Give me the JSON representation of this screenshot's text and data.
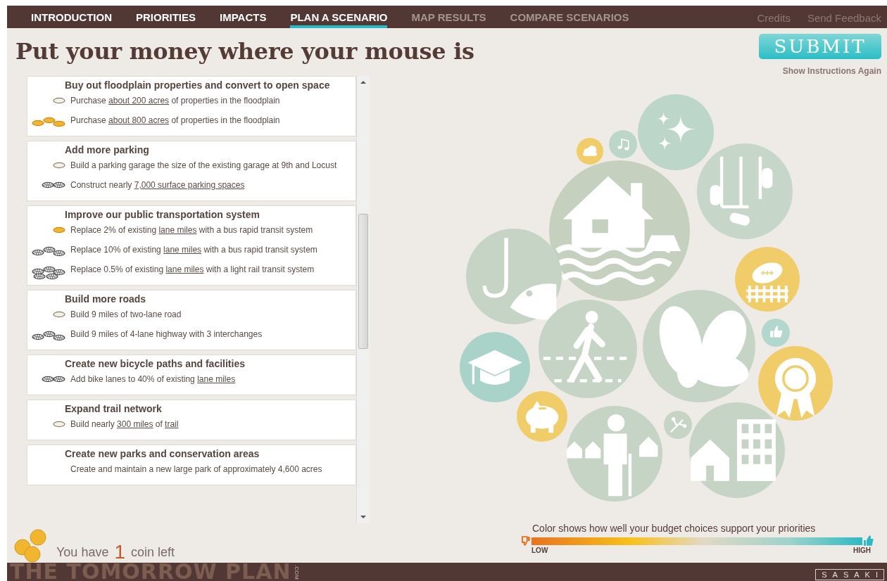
{
  "nav": {
    "tabs": [
      {
        "label": "INTRODUCTION",
        "selected": false,
        "disabled": false
      },
      {
        "label": "PRIORITIES",
        "selected": false,
        "disabled": false
      },
      {
        "label": "IMPACTS",
        "selected": false,
        "disabled": false
      },
      {
        "label": "PLAN A SCENARIO",
        "selected": true,
        "disabled": false
      },
      {
        "label": "MAP RESULTS",
        "selected": false,
        "disabled": true
      },
      {
        "label": "COMPARE SCENARIOS",
        "selected": false,
        "disabled": true
      }
    ],
    "links": [
      "Credits",
      "Send Feedback"
    ]
  },
  "title": "Put your money where your mouse is",
  "submit": "SUBMIT",
  "instructions_link": "Show Instructions Again",
  "projects": [
    {
      "heading": "Buy out floodplain properties and convert to open space",
      "options": [
        {
          "kind": "outline_single",
          "parts": [
            {
              "text": "Purchase "
            },
            {
              "text": "about 200 acres",
              "link": true
            },
            {
              "text": " of properties in the floodplain"
            }
          ]
        },
        {
          "kind": "gold_triple",
          "parts": [
            {
              "text": "Purchase "
            },
            {
              "text": "about 800 acres",
              "link": true
            },
            {
              "text": " of properties in the floodplain"
            }
          ]
        }
      ]
    },
    {
      "heading": "Add more parking",
      "options": [
        {
          "kind": "outline_single",
          "parts": [
            {
              "text": "Build a parking garage the size of the existing garage at 9th and Locust"
            }
          ]
        },
        {
          "kind": "striped_double",
          "parts": [
            {
              "text": "Construct nearly "
            },
            {
              "text": "7,000 surface parking spaces",
              "link": true
            }
          ]
        }
      ]
    },
    {
      "heading": "Improve our public transportation system",
      "options": [
        {
          "kind": "gold_single",
          "parts": [
            {
              "text": "Replace 2% of existing "
            },
            {
              "text": "lane miles",
              "link": true
            },
            {
              "text": " with a bus rapid transit system"
            }
          ]
        },
        {
          "kind": "striped_triple",
          "parts": [
            {
              "text": "Replace 10% of existing "
            },
            {
              "text": "lane miles",
              "link": true
            },
            {
              "text": " with a bus rapid transit system"
            }
          ]
        },
        {
          "kind": "striped_pile",
          "parts": [
            {
              "text": "Replace 0.5% of existing "
            },
            {
              "text": "lane miles",
              "link": true
            },
            {
              "text": " with a light rail transit system"
            }
          ]
        }
      ]
    },
    {
      "heading": "Build more roads",
      "options": [
        {
          "kind": "outline_single",
          "parts": [
            {
              "text": "Build 9 miles of two-lane road"
            }
          ]
        },
        {
          "kind": "striped_triple",
          "parts": [
            {
              "text": "Build 9 miles of 4-lane highway with 3 interchanges"
            }
          ]
        }
      ]
    },
    {
      "heading": "Create new bicycle paths and facilities",
      "options": [
        {
          "kind": "striped_double",
          "parts": [
            {
              "text": "Add bike lanes to 40% of existing "
            },
            {
              "text": "lane miles",
              "link": true
            }
          ]
        }
      ]
    },
    {
      "heading": "Expand trail network",
      "options": [
        {
          "kind": "outline_single",
          "parts": [
            {
              "text": "Build nearly "
            },
            {
              "text": "300 miles",
              "link": true
            },
            {
              "text": " of "
            },
            {
              "text": "trail",
              "link": true
            }
          ]
        }
      ]
    },
    {
      "heading": "Create new parks and conservation areas",
      "options": [
        {
          "parts": [
            {
              "text": "Create and maintain a new large park of approximately 4,600 acres"
            }
          ]
        }
      ]
    }
  ],
  "budget": {
    "prefix": "You have",
    "count": "1",
    "suffix": "coin left"
  },
  "bubbles": [
    {
      "kind": "stars",
      "color": "#bcd6c9"
    },
    {
      "kind": "music-notes",
      "color": "#bcd6c9"
    },
    {
      "kind": "cloud",
      "color": "#f0cd69"
    },
    {
      "kind": "parking-lot",
      "color": "#c6d6c8"
    },
    {
      "kind": "house-flood",
      "color": "#c5d0be"
    },
    {
      "kind": "fish-hook",
      "color": "#c6d4c5"
    },
    {
      "kind": "football",
      "color": "#f0cd69"
    },
    {
      "kind": "pedestrian",
      "color": "#c6d4c5"
    },
    {
      "kind": "butterfly",
      "color": "#c6d4c5"
    },
    {
      "kind": "thumbs-up",
      "color": "#b2d7cd"
    },
    {
      "kind": "graduation-cap",
      "color": "#a9d3c9"
    },
    {
      "kind": "ribbon-award",
      "color": "#f0cd69"
    },
    {
      "kind": "piggy-bank",
      "color": "#f0cd69"
    },
    {
      "kind": "elderly-person",
      "color": "#c6d4c5"
    },
    {
      "kind": "tree",
      "color": "#c6d4c5"
    },
    {
      "kind": "house-building",
      "color": "#c6d4c5"
    }
  ],
  "legend": {
    "caption": "Color shows how well your budget choices support your priorities",
    "low": "LOW",
    "high": "HIGH"
  },
  "footer": {
    "brand": "THE TOMORROW PLAN",
    "brand_suffix": ".COM",
    "partner": "SASAKI"
  }
}
